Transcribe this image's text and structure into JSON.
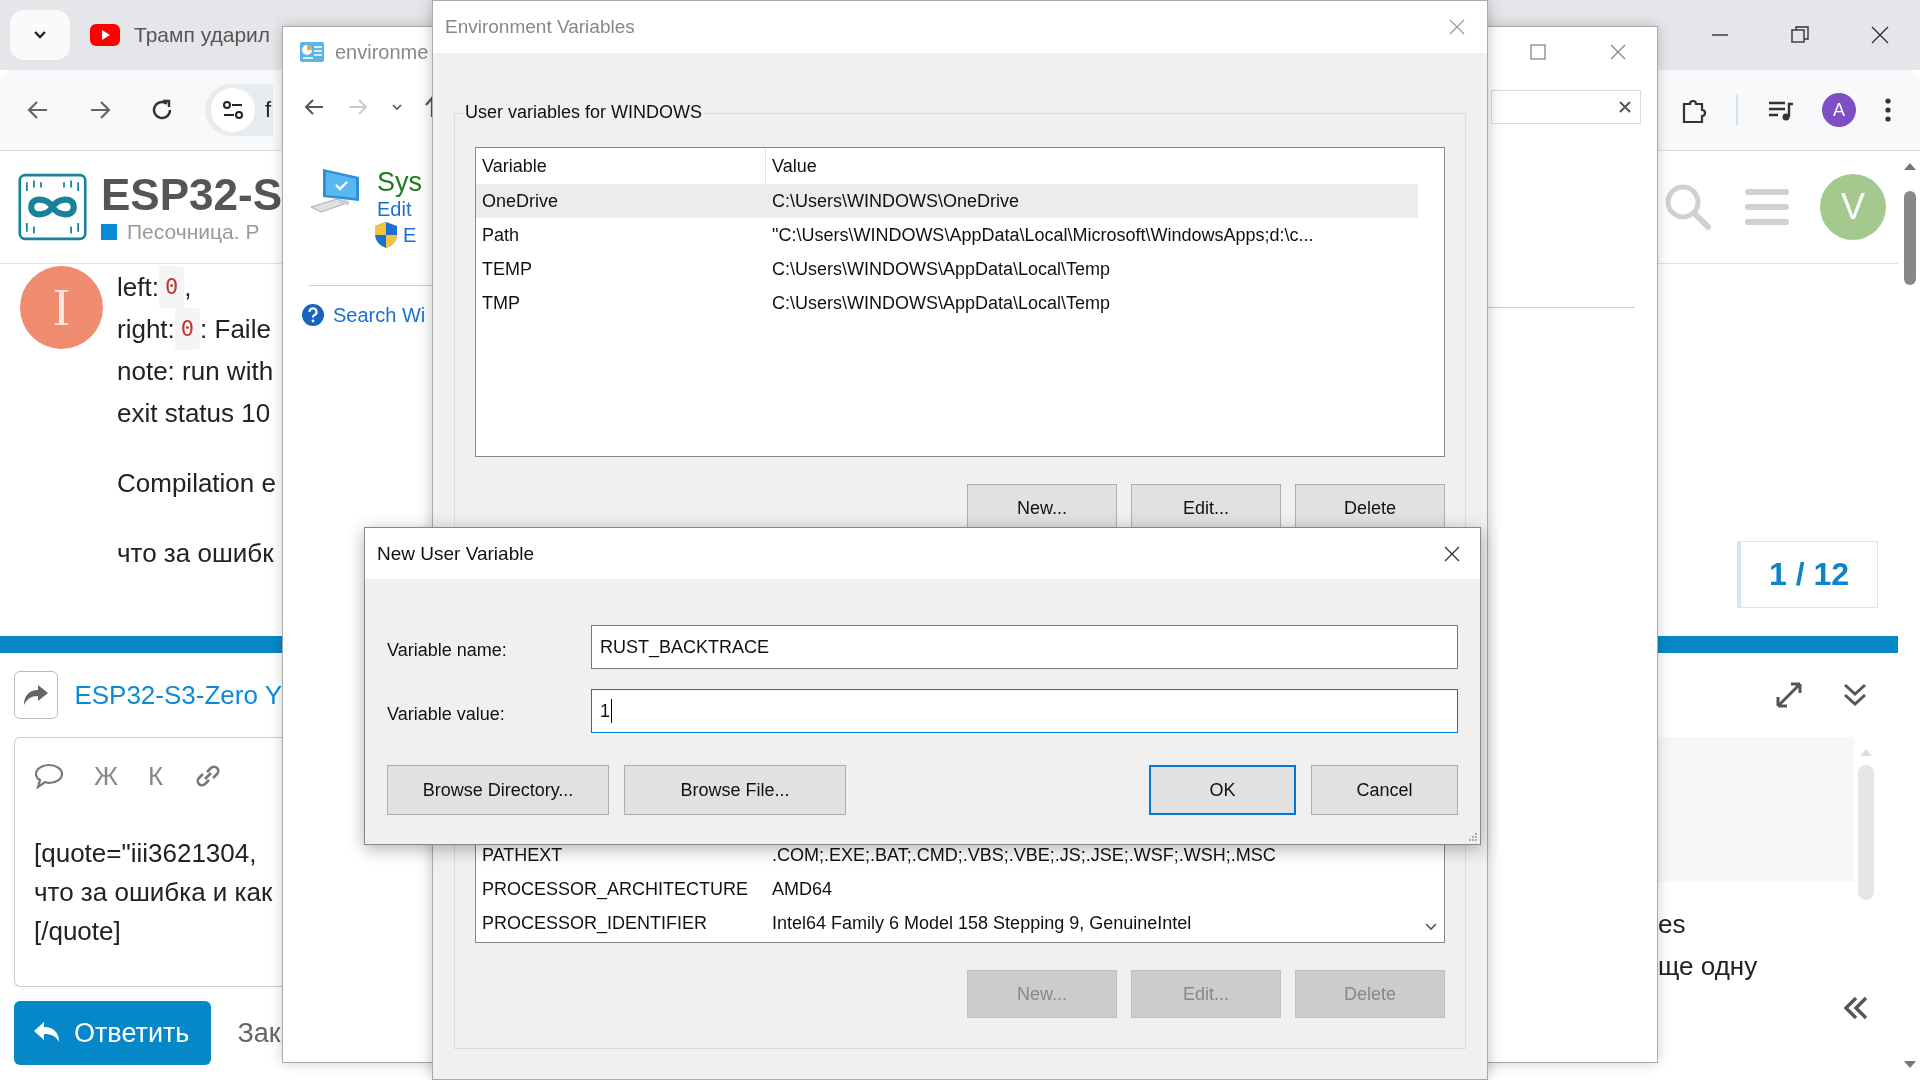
{
  "browser": {
    "tab_title": "Трамп ударил",
    "address_fragment": "f",
    "profile_initial": "A"
  },
  "page": {
    "site_title": "ESP32-S",
    "breadcrumb": "Песочница. Р",
    "user_initial": "V",
    "author_initial": "I",
    "post_lines": [
      {
        "kind": "mixed",
        "parts": [
          {
            "kind": "text",
            "text": "left: "
          },
          {
            "kind": "code",
            "text": "0"
          },
          {
            "kind": "text",
            "text": ","
          }
        ]
      },
      {
        "kind": "mixed",
        "parts": [
          {
            "kind": "text",
            "text": "right: "
          },
          {
            "kind": "code",
            "text": "0"
          },
          {
            "kind": "text",
            "text": ": Faile"
          }
        ]
      },
      {
        "kind": "text",
        "text": "note: run with"
      },
      {
        "kind": "text",
        "text": "exit status 10"
      },
      {
        "kind": "gap"
      },
      {
        "kind": "text",
        "text": "Compilation e"
      },
      {
        "kind": "gap"
      },
      {
        "kind": "text",
        "text": "что за ошибк"
      }
    ],
    "counter": "1 / 12",
    "topic_link": "ESP32-S3-Zero Y",
    "editor_tools": [
      {
        "kind": "quote"
      },
      {
        "kind": "letter",
        "text": "Ж"
      },
      {
        "kind": "letter",
        "text": "К"
      },
      {
        "kind": "link"
      }
    ],
    "editor_lines": [
      "[quote=\"iii3621304, ",
      "что за ошибка и как",
      "[/quote]"
    ],
    "reply_button": "Ответить",
    "close_link": "Зак",
    "side_lines": [
      "es",
      "ще одну"
    ]
  },
  "explorer": {
    "title": "environme",
    "heading": "Sys",
    "edit_link": "Edit",
    "shield_link": "E",
    "help_link": "Search Wi"
  },
  "env_dialog": {
    "title": "Environment Variables",
    "user_group": "User variables for WINDOWS",
    "columns": [
      "Variable",
      "Value"
    ],
    "user_rows": [
      {
        "name": "OneDrive",
        "value": "C:\\Users\\WINDOWS\\OneDrive",
        "selected": true
      },
      {
        "name": "Path",
        "value": "\"C:\\Users\\WINDOWS\\AppData\\Local\\Microsoft\\WindowsApps;d:\\c...",
        "selected": false
      },
      {
        "name": "TEMP",
        "value": "C:\\Users\\WINDOWS\\AppData\\Local\\Temp",
        "selected": false
      },
      {
        "name": "TMP",
        "value": "C:\\Users\\WINDOWS\\AppData\\Local\\Temp",
        "selected": false
      }
    ],
    "user_buttons": [
      {
        "label": "New...",
        "disabled": false
      },
      {
        "label": "Edit...",
        "disabled": false
      },
      {
        "label": "Delete",
        "disabled": false
      }
    ],
    "system_rows": [
      {
        "name": "PATHEXT",
        "value": ".COM;.EXE;.BAT;.CMD;.VBS;.VBE;.JS;.JSE;.WSF;.WSH;.MSC"
      },
      {
        "name": "PROCESSOR_ARCHITECTURE",
        "value": "AMD64"
      },
      {
        "name": "PROCESSOR_IDENTIFIER",
        "value": "Intel64 Family 6 Model 158 Stepping 9, GenuineIntel"
      }
    ],
    "system_buttons": [
      {
        "label": "New...",
        "disabled": true
      },
      {
        "label": "Edit...",
        "disabled": true
      },
      {
        "label": "Delete",
        "disabled": true
      }
    ]
  },
  "new_variable": {
    "title": "New User Variable",
    "fields": [
      {
        "label": "Variable name:",
        "value": "RUST_BACKTRACE",
        "focused": false
      },
      {
        "label": "Variable value:",
        "value": "1",
        "focused": true
      }
    ],
    "left_buttons": [
      {
        "label": "Browse Directory...",
        "default": false
      },
      {
        "label": "Browse File...",
        "default": false
      }
    ],
    "right_buttons": [
      {
        "label": "OK",
        "default": true
      },
      {
        "label": "Cancel",
        "default": false
      }
    ]
  }
}
